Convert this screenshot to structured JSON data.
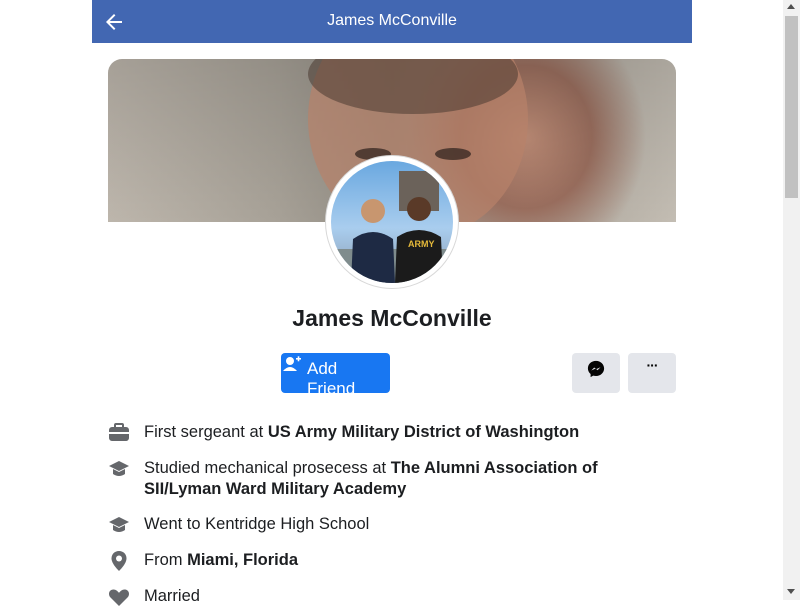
{
  "header": {
    "title": "James McConville",
    "back_icon": "arrow-left-icon"
  },
  "profile": {
    "name": "James McConville",
    "avatar_shirt_text": "ARMY"
  },
  "actions": {
    "add_friend_label": "Add Friend",
    "messenger_icon": "messenger-icon",
    "more_label": "···"
  },
  "about": [
    {
      "icon": "briefcase-icon",
      "prefix": "First sergeant at ",
      "bold": "US Army Military District of Washington",
      "suffix": ""
    },
    {
      "icon": "graduation-cap-icon",
      "prefix": "Studied mechanical prosecess at ",
      "bold": "The Alumni Association of SII/Lyman Ward Military Academy",
      "suffix": ""
    },
    {
      "icon": "graduation-cap-icon",
      "prefix": "Went to Kentridge High School",
      "bold": "",
      "suffix": ""
    },
    {
      "icon": "location-pin-icon",
      "prefix": "From ",
      "bold": "Miami, Florida",
      "suffix": ""
    },
    {
      "icon": "heart-icon",
      "prefix": "Married",
      "bold": "",
      "suffix": ""
    }
  ],
  "colors": {
    "header_bg": "#4267b2",
    "primary_button": "#1877f2",
    "secondary_button": "#e4e6eb"
  }
}
